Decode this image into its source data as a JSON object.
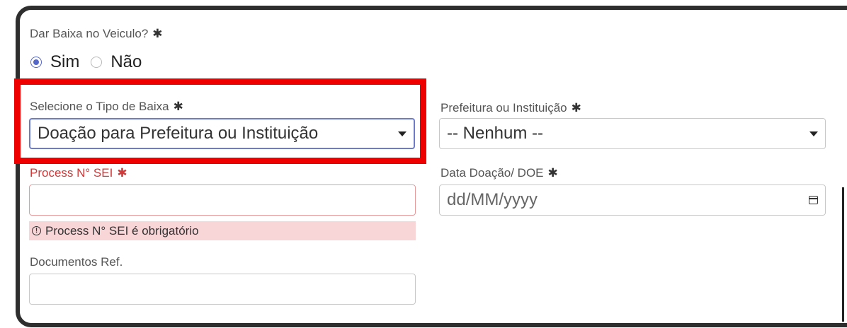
{
  "form": {
    "dar_baixa": {
      "label": "Dar Baixa no Veiculo?",
      "required_mark": "✱",
      "options": [
        "Sim",
        "Não"
      ],
      "selected": "Sim"
    },
    "tipo_baixa": {
      "label": "Selecione o Tipo de Baixa",
      "required_mark": "✱",
      "value": "Doação para Prefeitura ou Instituição"
    },
    "prefeitura": {
      "label": "Prefeitura ou Instituição",
      "required_mark": "✱",
      "value": "-- Nenhum --"
    },
    "process_sei": {
      "label": "Process N° SEI",
      "required_mark": "✱",
      "value": "",
      "error": "Process N° SEI é obrigatório"
    },
    "data_doacao": {
      "label": "Data Doação/ DOE",
      "required_mark": "✱",
      "placeholder": "dd/MM/yyyy"
    },
    "documentos_ref": {
      "label": "Documentos Ref.",
      "value": ""
    }
  },
  "colors": {
    "highlight": "#ee0000",
    "accent": "#5567c8",
    "error_text": "#d03a3a",
    "error_bg": "#f8d6d8"
  }
}
